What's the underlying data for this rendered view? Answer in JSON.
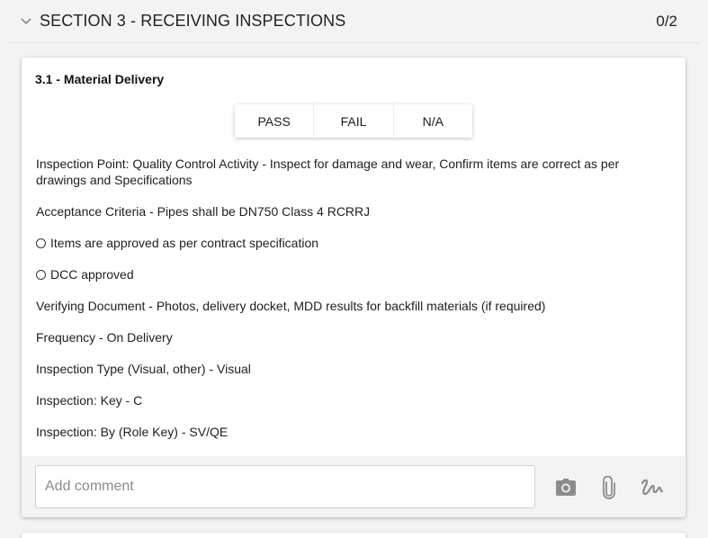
{
  "section": {
    "title": "SECTION 3 - RECEIVING INSPECTIONS",
    "count": "0/2"
  },
  "item": {
    "title": "3.1 - Material Delivery",
    "buttons": {
      "pass": "PASS",
      "fail": "FAIL",
      "na": "N/A"
    },
    "inspection_point": "Inspection Point: Quality Control Activity - Inspect for damage and wear, Confirm items are correct as per drawings and Specifications",
    "acceptance_criteria": "Acceptance Criteria - Pipes shall be DN750 Class 4 RCRRJ",
    "options": [
      "Items are approved as per contract specification",
      "DCC approved"
    ],
    "verifying_document": "Verifying Document - Photos, delivery docket, MDD results for backfill materials (if required)",
    "frequency": "Frequency - On Delivery",
    "inspection_type": "Inspection Type (Visual, other) - Visual",
    "inspection_key": "Inspection: Key - C",
    "inspection_by": "Inspection: By (Role Key) - SV/QE"
  },
  "footer": {
    "comment_placeholder": "Add comment",
    "icons": [
      "camera-icon",
      "paperclip-icon",
      "signature-icon"
    ]
  },
  "colors": {
    "page_bg": "#f3f3f3",
    "card_bg": "#ffffff",
    "icon_gray": "#8c8c8c"
  }
}
